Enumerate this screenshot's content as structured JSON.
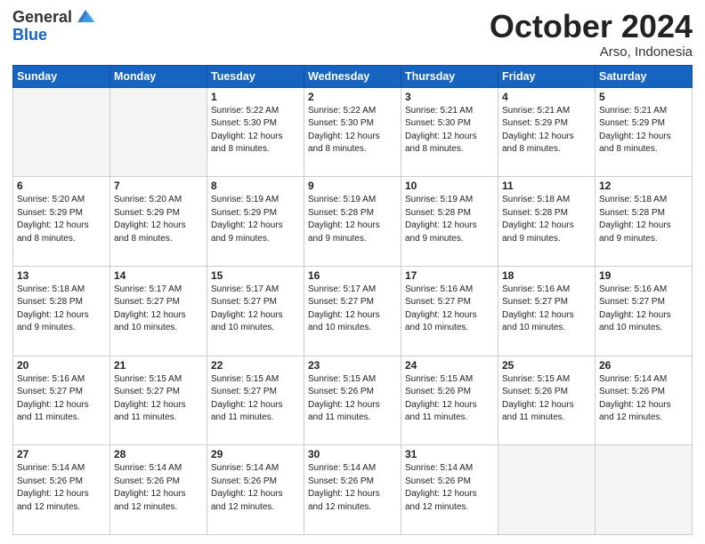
{
  "header": {
    "logo_general": "General",
    "logo_blue": "Blue",
    "month_title": "October 2024",
    "location": "Arso, Indonesia"
  },
  "weekdays": [
    "Sunday",
    "Monday",
    "Tuesday",
    "Wednesday",
    "Thursday",
    "Friday",
    "Saturday"
  ],
  "weeks": [
    [
      {
        "day": "",
        "sunrise": "",
        "sunset": "",
        "daylight": ""
      },
      {
        "day": "",
        "sunrise": "",
        "sunset": "",
        "daylight": ""
      },
      {
        "day": "1",
        "sunrise": "Sunrise: 5:22 AM",
        "sunset": "Sunset: 5:30 PM",
        "daylight": "Daylight: 12 hours and 8 minutes."
      },
      {
        "day": "2",
        "sunrise": "Sunrise: 5:22 AM",
        "sunset": "Sunset: 5:30 PM",
        "daylight": "Daylight: 12 hours and 8 minutes."
      },
      {
        "day": "3",
        "sunrise": "Sunrise: 5:21 AM",
        "sunset": "Sunset: 5:30 PM",
        "daylight": "Daylight: 12 hours and 8 minutes."
      },
      {
        "day": "4",
        "sunrise": "Sunrise: 5:21 AM",
        "sunset": "Sunset: 5:29 PM",
        "daylight": "Daylight: 12 hours and 8 minutes."
      },
      {
        "day": "5",
        "sunrise": "Sunrise: 5:21 AM",
        "sunset": "Sunset: 5:29 PM",
        "daylight": "Daylight: 12 hours and 8 minutes."
      }
    ],
    [
      {
        "day": "6",
        "sunrise": "Sunrise: 5:20 AM",
        "sunset": "Sunset: 5:29 PM",
        "daylight": "Daylight: 12 hours and 8 minutes."
      },
      {
        "day": "7",
        "sunrise": "Sunrise: 5:20 AM",
        "sunset": "Sunset: 5:29 PM",
        "daylight": "Daylight: 12 hours and 8 minutes."
      },
      {
        "day": "8",
        "sunrise": "Sunrise: 5:19 AM",
        "sunset": "Sunset: 5:29 PM",
        "daylight": "Daylight: 12 hours and 9 minutes."
      },
      {
        "day": "9",
        "sunrise": "Sunrise: 5:19 AM",
        "sunset": "Sunset: 5:28 PM",
        "daylight": "Daylight: 12 hours and 9 minutes."
      },
      {
        "day": "10",
        "sunrise": "Sunrise: 5:19 AM",
        "sunset": "Sunset: 5:28 PM",
        "daylight": "Daylight: 12 hours and 9 minutes."
      },
      {
        "day": "11",
        "sunrise": "Sunrise: 5:18 AM",
        "sunset": "Sunset: 5:28 PM",
        "daylight": "Daylight: 12 hours and 9 minutes."
      },
      {
        "day": "12",
        "sunrise": "Sunrise: 5:18 AM",
        "sunset": "Sunset: 5:28 PM",
        "daylight": "Daylight: 12 hours and 9 minutes."
      }
    ],
    [
      {
        "day": "13",
        "sunrise": "Sunrise: 5:18 AM",
        "sunset": "Sunset: 5:28 PM",
        "daylight": "Daylight: 12 hours and 9 minutes."
      },
      {
        "day": "14",
        "sunrise": "Sunrise: 5:17 AM",
        "sunset": "Sunset: 5:27 PM",
        "daylight": "Daylight: 12 hours and 10 minutes."
      },
      {
        "day": "15",
        "sunrise": "Sunrise: 5:17 AM",
        "sunset": "Sunset: 5:27 PM",
        "daylight": "Daylight: 12 hours and 10 minutes."
      },
      {
        "day": "16",
        "sunrise": "Sunrise: 5:17 AM",
        "sunset": "Sunset: 5:27 PM",
        "daylight": "Daylight: 12 hours and 10 minutes."
      },
      {
        "day": "17",
        "sunrise": "Sunrise: 5:16 AM",
        "sunset": "Sunset: 5:27 PM",
        "daylight": "Daylight: 12 hours and 10 minutes."
      },
      {
        "day": "18",
        "sunrise": "Sunrise: 5:16 AM",
        "sunset": "Sunset: 5:27 PM",
        "daylight": "Daylight: 12 hours and 10 minutes."
      },
      {
        "day": "19",
        "sunrise": "Sunrise: 5:16 AM",
        "sunset": "Sunset: 5:27 PM",
        "daylight": "Daylight: 12 hours and 10 minutes."
      }
    ],
    [
      {
        "day": "20",
        "sunrise": "Sunrise: 5:16 AM",
        "sunset": "Sunset: 5:27 PM",
        "daylight": "Daylight: 12 hours and 11 minutes."
      },
      {
        "day": "21",
        "sunrise": "Sunrise: 5:15 AM",
        "sunset": "Sunset: 5:27 PM",
        "daylight": "Daylight: 12 hours and 11 minutes."
      },
      {
        "day": "22",
        "sunrise": "Sunrise: 5:15 AM",
        "sunset": "Sunset: 5:27 PM",
        "daylight": "Daylight: 12 hours and 11 minutes."
      },
      {
        "day": "23",
        "sunrise": "Sunrise: 5:15 AM",
        "sunset": "Sunset: 5:26 PM",
        "daylight": "Daylight: 12 hours and 11 minutes."
      },
      {
        "day": "24",
        "sunrise": "Sunrise: 5:15 AM",
        "sunset": "Sunset: 5:26 PM",
        "daylight": "Daylight: 12 hours and 11 minutes."
      },
      {
        "day": "25",
        "sunrise": "Sunrise: 5:15 AM",
        "sunset": "Sunset: 5:26 PM",
        "daylight": "Daylight: 12 hours and 11 minutes."
      },
      {
        "day": "26",
        "sunrise": "Sunrise: 5:14 AM",
        "sunset": "Sunset: 5:26 PM",
        "daylight": "Daylight: 12 hours and 12 minutes."
      }
    ],
    [
      {
        "day": "27",
        "sunrise": "Sunrise: 5:14 AM",
        "sunset": "Sunset: 5:26 PM",
        "daylight": "Daylight: 12 hours and 12 minutes."
      },
      {
        "day": "28",
        "sunrise": "Sunrise: 5:14 AM",
        "sunset": "Sunset: 5:26 PM",
        "daylight": "Daylight: 12 hours and 12 minutes."
      },
      {
        "day": "29",
        "sunrise": "Sunrise: 5:14 AM",
        "sunset": "Sunset: 5:26 PM",
        "daylight": "Daylight: 12 hours and 12 minutes."
      },
      {
        "day": "30",
        "sunrise": "Sunrise: 5:14 AM",
        "sunset": "Sunset: 5:26 PM",
        "daylight": "Daylight: 12 hours and 12 minutes."
      },
      {
        "day": "31",
        "sunrise": "Sunrise: 5:14 AM",
        "sunset": "Sunset: 5:26 PM",
        "daylight": "Daylight: 12 hours and 12 minutes."
      },
      {
        "day": "",
        "sunrise": "",
        "sunset": "",
        "daylight": ""
      },
      {
        "day": "",
        "sunrise": "",
        "sunset": "",
        "daylight": ""
      }
    ]
  ]
}
